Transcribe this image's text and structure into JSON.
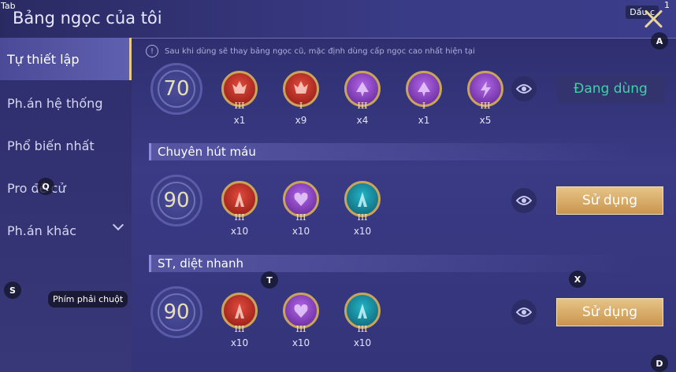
{
  "header": {
    "tab_hint": "Tab",
    "title": "Bảng ngọc của tôi",
    "close_hint": "Dấu c",
    "corner_hint": "1"
  },
  "sidebar": {
    "items": [
      {
        "label": "Tự thiết lập"
      },
      {
        "label": "Ph.án hệ thống"
      },
      {
        "label": "Phổ biến nhất"
      },
      {
        "label": "Pro đề cử"
      },
      {
        "label": "Ph.án khác"
      }
    ]
  },
  "info_text": "Sau khi dùng sẽ thay bảng ngọc cũ, mặc định dùng cấp ngọc cao nhất hiện tại",
  "pages": [
    {
      "title": "",
      "level": "70",
      "button": "Đang dùng",
      "gems": [
        {
          "color": "red",
          "tier": "III",
          "count": "x1"
        },
        {
          "color": "red",
          "tier": "I",
          "count": "x9"
        },
        {
          "color": "purple",
          "tier": "III",
          "count": "x4"
        },
        {
          "color": "purple",
          "tier": "I",
          "count": "x1"
        },
        {
          "color": "purple",
          "tier": "III",
          "count": "x5"
        }
      ]
    },
    {
      "title": "Chuyên hút máu",
      "level": "90",
      "button": "Sử dụng",
      "gems": [
        {
          "color": "red",
          "tier": "III",
          "count": "x10"
        },
        {
          "color": "purple",
          "tier": "III",
          "count": "x10"
        },
        {
          "color": "teal",
          "tier": "III",
          "count": "x10"
        }
      ]
    },
    {
      "title": "ST, diệt nhanh",
      "level": "90",
      "button": "Sử dụng",
      "gems": [
        {
          "color": "red",
          "tier": "III",
          "count": "x10"
        },
        {
          "color": "purple",
          "tier": "III",
          "count": "x10"
        },
        {
          "color": "teal",
          "tier": "III",
          "count": "x10"
        }
      ]
    }
  ],
  "key_hints": {
    "a": "A",
    "q": "Q",
    "s": "S",
    "t": "T",
    "x": "X",
    "d": "D"
  },
  "tooltip": "Phím phải chuột",
  "colors": {
    "accent_gold": "#e7c98a",
    "using_green": "#3fd1a8"
  }
}
